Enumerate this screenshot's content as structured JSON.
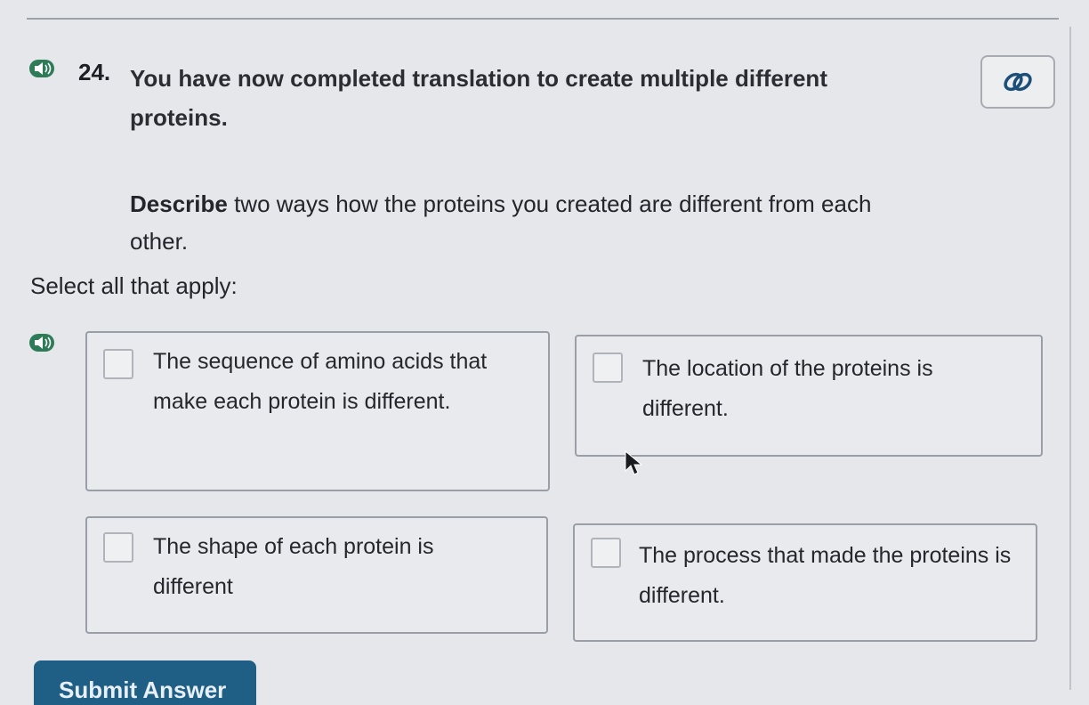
{
  "question": {
    "number": "24.",
    "text": "You have now completed translation to create multiple different proteins.",
    "description_bold": "Describe",
    "description_rest": " two ways how the proteins you created are different from each other.",
    "instruction": "Select all that apply:"
  },
  "options": [
    {
      "label": "The sequence of amino acids that make each protein is different."
    },
    {
      "label": "The location of the proteins is different."
    },
    {
      "label": "The shape of each protein is different"
    },
    {
      "label": "The process that made the proteins is different."
    }
  ],
  "submit": {
    "label": "Submit Answer"
  },
  "icons": {
    "audio": "speaker-icon",
    "link": "link-icon",
    "cursor": "mouse-pointer-icon"
  },
  "colors": {
    "background": "#e6e7ea",
    "submit": "#1f5f86",
    "audio_badge": "#2e7b57",
    "link_icon": "#1c4e78"
  }
}
